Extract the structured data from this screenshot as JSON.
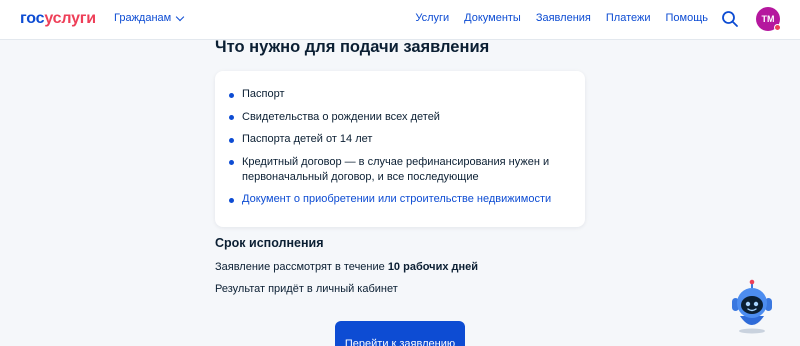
{
  "header": {
    "logo_part1": "гос",
    "logo_part2": "услуги",
    "audience_label": "Гражданам",
    "nav": [
      {
        "label": "Услуги"
      },
      {
        "label": "Документы"
      },
      {
        "label": "Заявления"
      },
      {
        "label": "Платежи"
      },
      {
        "label": "Помощь"
      }
    ],
    "avatar_initials": "ТМ"
  },
  "requirements": {
    "title": "Что нужно для подачи заявления",
    "items": [
      {
        "text": "Паспорт"
      },
      {
        "text": "Свидетельства о рождении всех детей"
      },
      {
        "text": "Паспорта детей от 14 лет"
      },
      {
        "text": "Кредитный договор — в случае рефинансирования нужен и первоначальный договор, и все последующие"
      },
      {
        "text": "Документ о приобретении или строительстве недвижимости",
        "is_link": true
      }
    ]
  },
  "term": {
    "title": "Срок исполнения",
    "review_prefix": "Заявление рассмотрят в течение ",
    "review_bold": "10 рабочих дней",
    "result": "Результат придёт в личный кабинет"
  },
  "cta": {
    "label": "Перейти к заявлению"
  },
  "icons": {
    "search": "search-icon",
    "chevron": "chevron-down-icon",
    "assistant": "robot-assistant-icon"
  },
  "colors": {
    "brand_blue": "#0d4cd3",
    "brand_red": "#ee3f58",
    "text": "#0b1f33",
    "page_bg": "#f5f7fa",
    "avatar_bg": "#b5179e"
  }
}
